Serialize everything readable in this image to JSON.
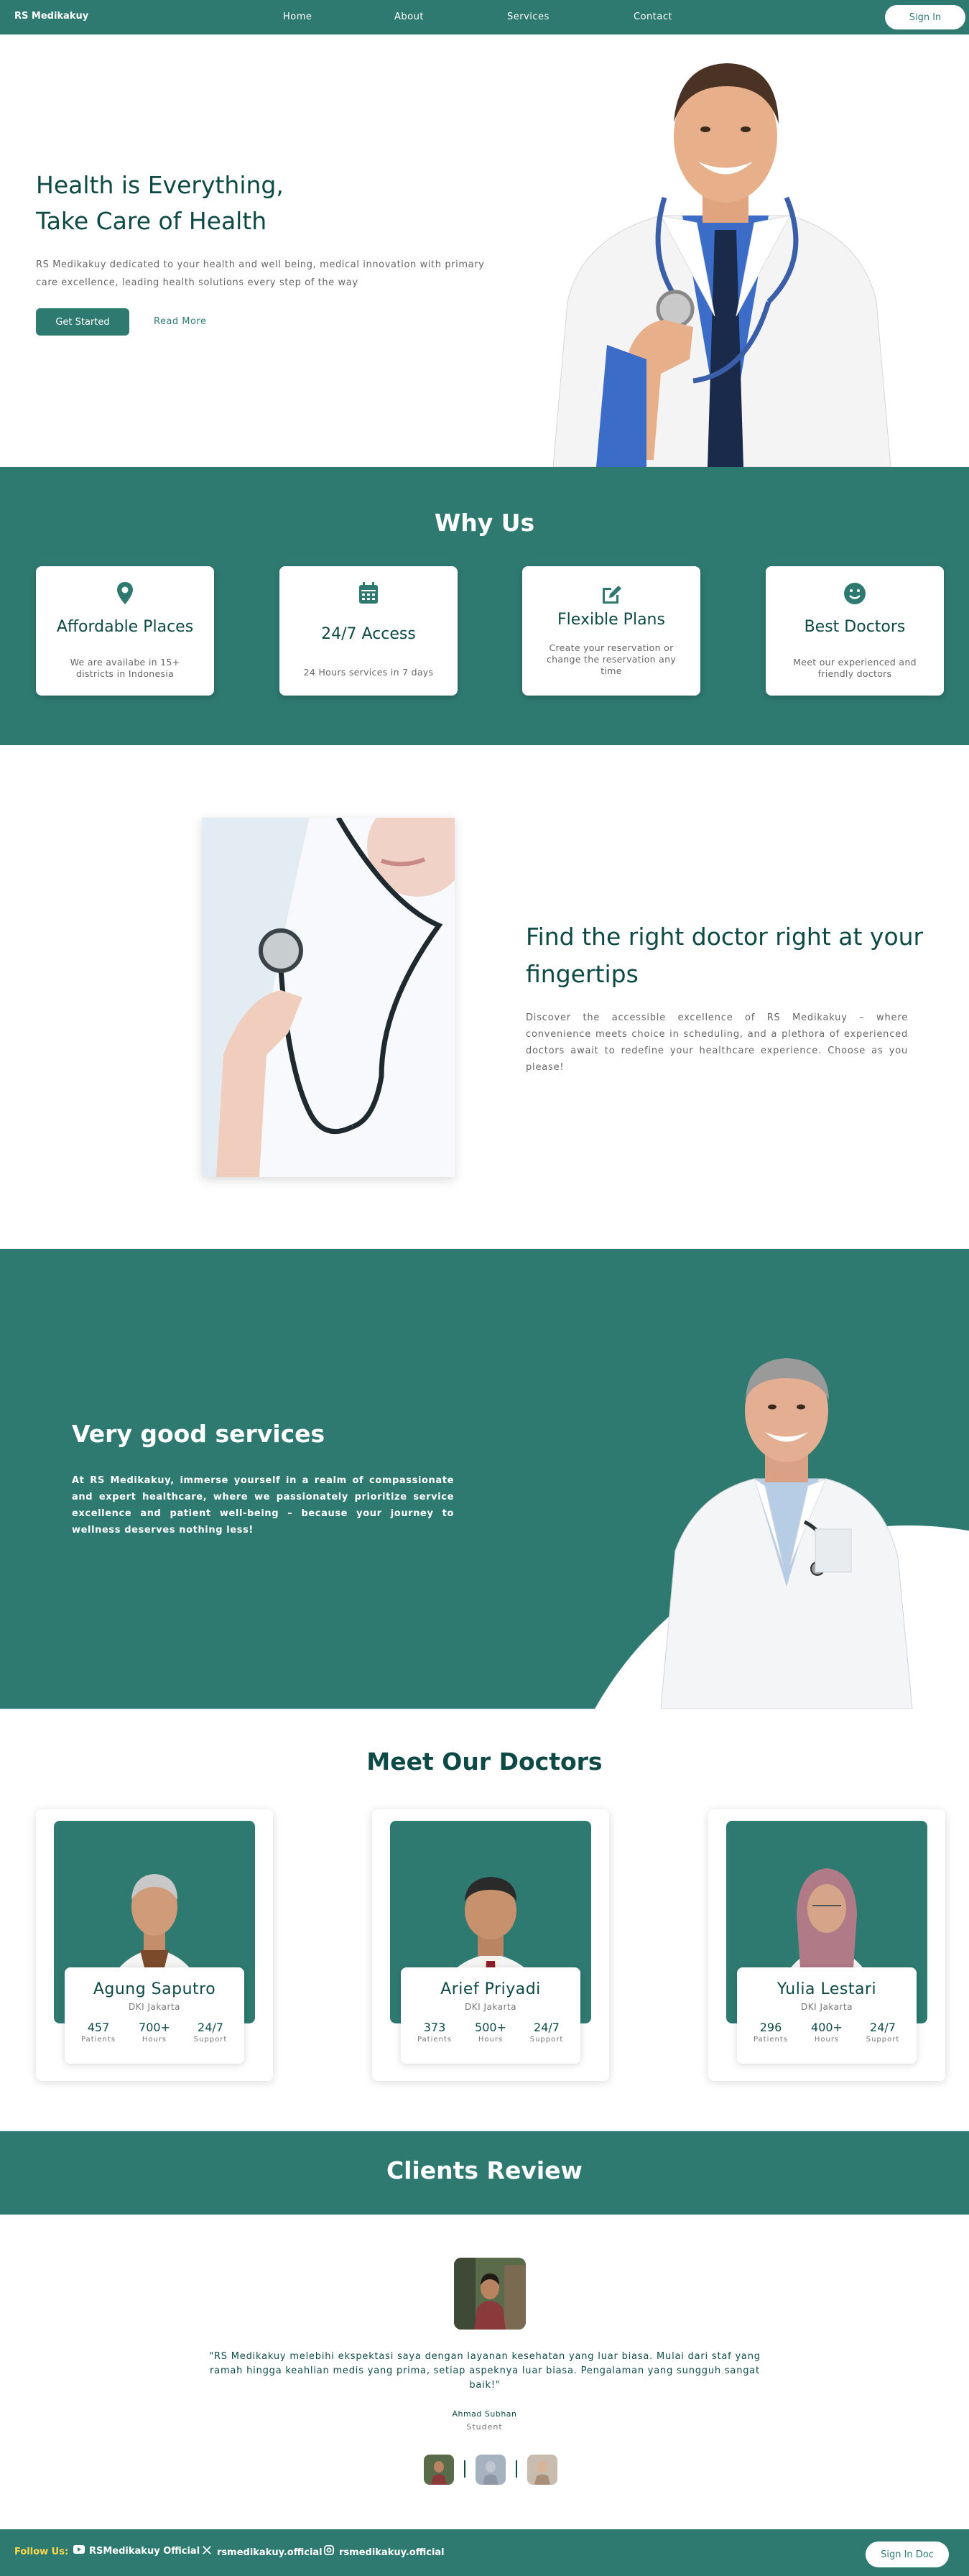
{
  "nav": {
    "brand": "RS Medikakuy",
    "links": [
      "Home",
      "About",
      "Services",
      "Contact"
    ],
    "signin_label": "Sign In"
  },
  "hero": {
    "title_line1": "Health is Everything,",
    "title_line2": "Take Care of Health",
    "description": "RS Medikakuy dedicated to your health and well being, medical innovation with primary care excellence, leading health solutions every step of the way",
    "primary_button": "Get Started",
    "secondary_link": "Read More"
  },
  "why_us": {
    "title": "Why Us",
    "cards": [
      {
        "icon": "location-pin-icon",
        "title": "Affordable Places",
        "desc": "We are availabe in 15+ districts in Indonesia"
      },
      {
        "icon": "calendar-icon",
        "title": "24/7 Access",
        "desc": "24 Hours services in 7 days"
      },
      {
        "icon": "edit-icon",
        "title": "Flexible Plans",
        "desc": "Create your reservation or change the reservation any time"
      },
      {
        "icon": "smile-icon",
        "title": "Best Doctors",
        "desc": "Meet our experienced and friendly doctors"
      }
    ]
  },
  "find": {
    "title": "Find the right doctor right at your fingertips",
    "description": "Discover the accessible excellence of RS Medikakuy – where convenience meets choice in scheduling, and a plethora of experienced doctors await to redefine your healthcare experience. Choose as you please!"
  },
  "services": {
    "title": "Very good services",
    "description": "At RS Medikakuy, immerse yourself in a realm of compassionate and expert healthcare, where we passionately prioritize service excellence and patient well-being – because your journey to wellness deserves nothing less!"
  },
  "doctors": {
    "title": "Meet Our Doctors",
    "items": [
      {
        "name": "Agung Saputro",
        "location": "DKI Jakarta",
        "stats": [
          {
            "num": "457",
            "label": "Patients"
          },
          {
            "num": "700+",
            "label": "Hours"
          },
          {
            "num": "24/7",
            "label": "Support"
          }
        ]
      },
      {
        "name": "Arief Priyadi",
        "location": "DKI Jakarta",
        "stats": [
          {
            "num": "373",
            "label": "Patients"
          },
          {
            "num": "500+",
            "label": "Hours"
          },
          {
            "num": "24/7",
            "label": "Support"
          }
        ]
      },
      {
        "name": "Yulia Lestari",
        "location": "DKI Jakarta",
        "stats": [
          {
            "num": "296",
            "label": "Patients"
          },
          {
            "num": "400+",
            "label": "Hours"
          },
          {
            "num": "24/7",
            "label": "Support"
          }
        ]
      }
    ]
  },
  "reviews": {
    "title": "Clients Review",
    "quote": "\"RS Medikakuy melebihi ekspektasi saya dengan layanan kesehatan yang luar biasa. Mulai dari staf yang ramah hingga keahlian medis yang prima, setiap aspeknya luar biasa. Pengalaman yang sungguh sangat baik!\"",
    "reviewer_name": "Ahmad Subhan",
    "reviewer_role": "Student"
  },
  "footer": {
    "follow_label": "Follow Us:",
    "socials": [
      {
        "icon": "youtube-icon",
        "label": "RSMedikakuy Official"
      },
      {
        "icon": "x-icon",
        "label": "rsmedikakuy.official"
      },
      {
        "icon": "instagram-icon",
        "label": "rsmedikakuy.official"
      }
    ],
    "signin_doc_label": "Sign In Doc"
  },
  "colors": {
    "primary": "#2e7a71",
    "text_dark": "#0e4a45",
    "accent_yellow": "#ffd84a"
  }
}
